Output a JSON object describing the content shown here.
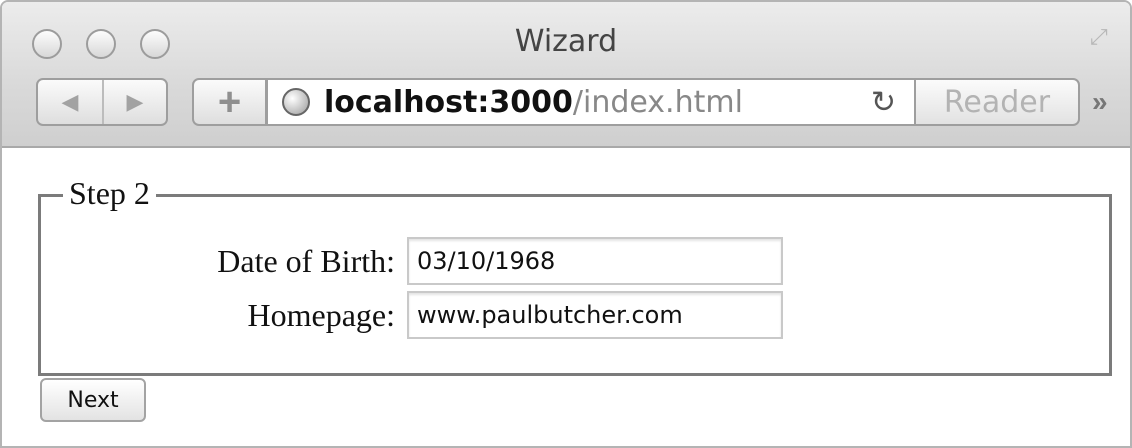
{
  "window": {
    "title": "Wizard"
  },
  "toolbar": {
    "back_icon": "◀",
    "forward_icon": "▶",
    "add_icon": "+",
    "address_host": "localhost:3000",
    "address_path": "/index.html",
    "reload_icon": "↻",
    "reader_label": "Reader",
    "overflow_icon": "»"
  },
  "form": {
    "legend": "Step 2",
    "fields": [
      {
        "label": "Date of Birth:",
        "value": "03/10/1968"
      },
      {
        "label": "Homepage:",
        "value": "www.paulbutcher.com"
      }
    ],
    "next_label": "Next"
  }
}
